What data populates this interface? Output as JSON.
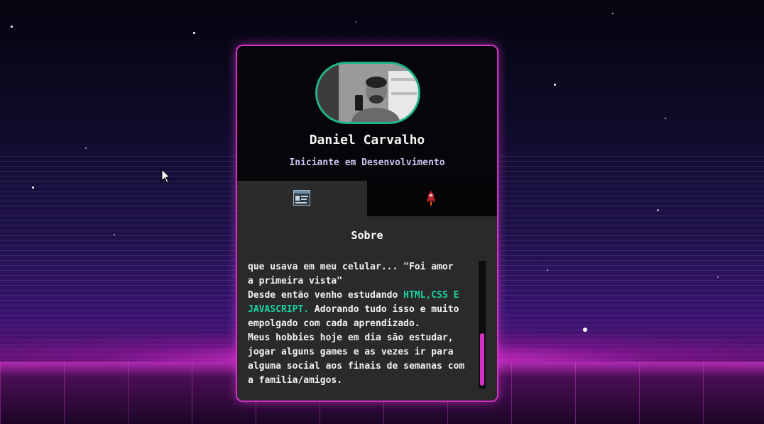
{
  "profile": {
    "name": "Daniel Carvalho",
    "role": "Iniciante em Desenvolvimento"
  },
  "tabs": [
    {
      "icon": "id-card-icon",
      "active": true
    },
    {
      "icon": "rocket-icon",
      "active": false
    }
  ],
  "about": {
    "title": "Sobre",
    "lines": {
      "l1": "que usava em meu celular... \"Foi amor",
      "l2": "a primeira vista\"",
      "l3_pre": "Desde então venho estudando ",
      "l3_hl": "HTML,CSS E JAVASCRIPT.",
      "l3_post": " Adorando tudo isso e muito empolgado com cada aprendizado.",
      "l4": "Meus hobbies hoje em dia são estudar, jogar alguns games e as vezes ir para alguma social aos finais de semanas com a familia/amigos."
    },
    "scroll_position": 0.85
  },
  "colors": {
    "accent": "#d630c8",
    "highlight": "#19d3a1",
    "avatar_border": "#1fb488"
  }
}
